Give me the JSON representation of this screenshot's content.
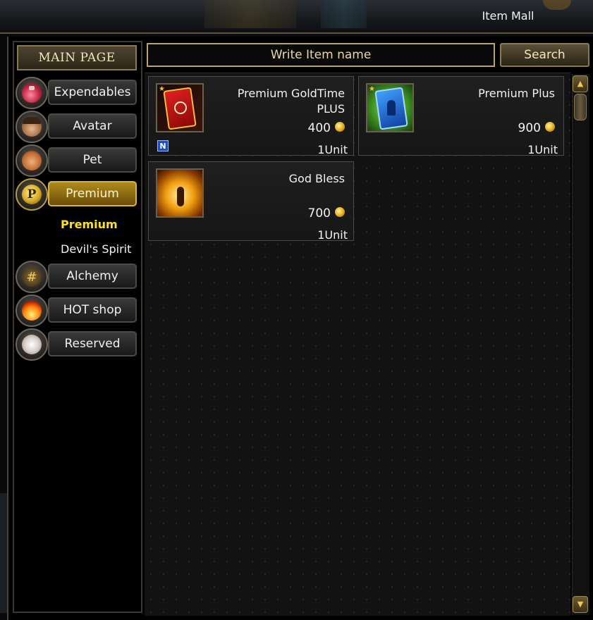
{
  "window": {
    "title": "Item Mall"
  },
  "sidebar": {
    "main_page_label": "MAIN PAGE",
    "categories": [
      {
        "label": "Expendables",
        "icon": "potion-icon"
      },
      {
        "label": "Avatar",
        "icon": "avatar-face-icon"
      },
      {
        "label": "Pet",
        "icon": "pet-squirrel-icon"
      },
      {
        "label": "Premium",
        "icon": "premium-p-coin-icon",
        "active": true
      },
      {
        "label": "Alchemy",
        "icon": "alchemy-grid-icon"
      },
      {
        "label": "HOT shop",
        "icon": "fire-icon"
      },
      {
        "label": "Reserved",
        "icon": "scroll-icon"
      }
    ],
    "premium_subitems": [
      {
        "label": "Premium",
        "selected": true
      },
      {
        "label": "Devil's Spirit",
        "selected": false
      }
    ]
  },
  "search": {
    "placeholder": "Write Item name",
    "button_label": "Search"
  },
  "items": [
    {
      "name": "Premium GoldTime PLUS",
      "price": "400",
      "unit": "1Unit",
      "badge": "N",
      "icon": "red-card-icon"
    },
    {
      "name": "Premium Plus",
      "price": "900",
      "unit": "1Unit",
      "icon": "blue-card-icon"
    },
    {
      "name": "God Bless",
      "price": "700",
      "unit": "1Unit",
      "icon": "golden-wings-icon"
    }
  ],
  "colors": {
    "active_category": "#b08a1c",
    "selected_subitem": "#ffe21a",
    "frame_gold": "#8a7a52"
  }
}
